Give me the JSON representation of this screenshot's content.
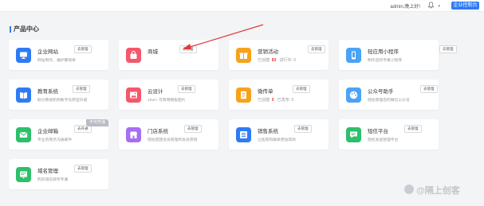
{
  "header": {
    "greeting": "admin,晚上好!",
    "console_label": "企业控制台"
  },
  "section": {
    "title": "产品中心"
  },
  "products": [
    {
      "id": "enterprise-site",
      "name": "企业网站",
      "badge": "去管理",
      "desc": "网站制作、维护都简单",
      "color": "#2f7bf5",
      "icon": "monitor-icon"
    },
    {
      "id": "mall",
      "name": "商城",
      "badge": "去管理",
      "color": "#f5576c",
      "icon": "shopping-bag-icon"
    },
    {
      "id": "marketing",
      "name": "营销活动",
      "badge": "去管理",
      "stat_label": "已创建:",
      "stat_value": "83",
      "stat2": "进行中: 0",
      "color": "#f7a21b",
      "icon": "gift-icon"
    },
    {
      "id": "mini-program",
      "name": "轻应用小程序",
      "badge": "去管理",
      "desc": "制作您的专属小程序",
      "color": "#4aa3f5",
      "icon": "phone-icon"
    },
    {
      "id": "education",
      "name": "教育系统",
      "badge": "去管理",
      "desc": "助力教培机构数字化转型升级",
      "color": "#2f7bf5",
      "icon": "book-icon"
    },
    {
      "id": "cloud-design",
      "name": "云设计",
      "badge": "去管理",
      "desc": "10W+ 可商用模板图片",
      "color": "#f5576c",
      "icon": "image-icon"
    },
    {
      "id": "flyer",
      "name": "微传单",
      "badge": "去管理",
      "stat_label": "已创建:",
      "stat_value": "0",
      "stat2": "已发布: 0",
      "color": "#f7a21b",
      "icon": "doc-icon"
    },
    {
      "id": "wechat-assistant",
      "name": "公众号助手",
      "badge": "去管理",
      "desc": "轻松管理您的微信公众号",
      "color": "#4aa3f5",
      "icon": "palette-icon"
    },
    {
      "id": "enterprise-mail",
      "name": "企业邮箱",
      "badge": "去开通",
      "desc": "专业的商务沟通邮件",
      "color": "#2dbf6a",
      "icon": "mail-icon",
      "corner": "不可开通"
    },
    {
      "id": "store-system",
      "name": "门店系统",
      "badge": "去管理",
      "desc": "轻松搭建会员管理和会员营销",
      "color": "#a76ef0",
      "icon": "store-icon"
    },
    {
      "id": "sales-system",
      "name": "销售系统",
      "badge": "去管理",
      "desc": "让拓客和跟单更加高效",
      "color": "#2f7bf5",
      "icon": "list-icon"
    },
    {
      "id": "sms",
      "name": "短信平台",
      "badge": "去管理",
      "desc": "轻松发送管理平台",
      "color": "#2dbf6a",
      "icon": "chat-icon"
    },
    {
      "id": "domain",
      "name": "域名管理",
      "badge": "去管理",
      "desc": "购买域名即享专属",
      "color": "#2dbf6a",
      "icon": "globe-icon"
    }
  ],
  "watermark": {
    "text": "@隔上创客"
  }
}
